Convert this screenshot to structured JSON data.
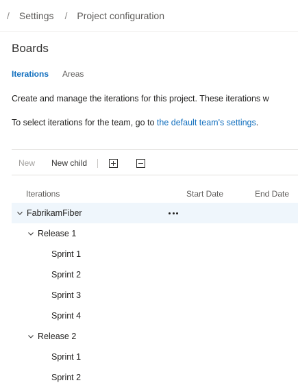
{
  "breadcrumb": {
    "separator": "/",
    "items": [
      "Settings",
      "Project configuration"
    ]
  },
  "page_title": "Boards",
  "tabs": [
    {
      "label": "Iterations",
      "active": true
    },
    {
      "label": "Areas",
      "active": false
    }
  ],
  "description": {
    "line1": "Create and manage the iterations for this project. These iterations w",
    "line2_prefix": "To select iterations for the team, go to ",
    "line2_link": "the default team's settings",
    "line2_suffix": "."
  },
  "toolbar": {
    "new_label": "New",
    "new_child_label": "New child",
    "expand_all_icon": "expand-all-icon",
    "collapse_all_icon": "collapse-all-icon"
  },
  "grid": {
    "columns": [
      "Iterations",
      "Start Date",
      "End Date"
    ],
    "rows": [
      {
        "label": "FabrikamFiber",
        "level": 0,
        "expanded": true,
        "selected": true,
        "start": "",
        "end": ""
      },
      {
        "label": "Release 1",
        "level": 1,
        "expanded": true,
        "selected": false,
        "start": "",
        "end": ""
      },
      {
        "label": "Sprint 1",
        "level": 2,
        "selected": false,
        "start": "",
        "end": ""
      },
      {
        "label": "Sprint 2",
        "level": 2,
        "selected": false,
        "start": "",
        "end": ""
      },
      {
        "label": "Sprint 3",
        "level": 2,
        "selected": false,
        "start": "",
        "end": ""
      },
      {
        "label": "Sprint 4",
        "level": 2,
        "selected": false,
        "start": "",
        "end": ""
      },
      {
        "label": "Release 2",
        "level": 1,
        "expanded": true,
        "selected": false,
        "start": "",
        "end": ""
      },
      {
        "label": "Sprint 1",
        "level": 2,
        "selected": false,
        "start": "",
        "end": ""
      },
      {
        "label": "Sprint 2",
        "level": 2,
        "selected": false,
        "start": "",
        "end": ""
      }
    ]
  },
  "colors": {
    "accent": "#106ebe",
    "selected_row": "#eff6fc"
  }
}
